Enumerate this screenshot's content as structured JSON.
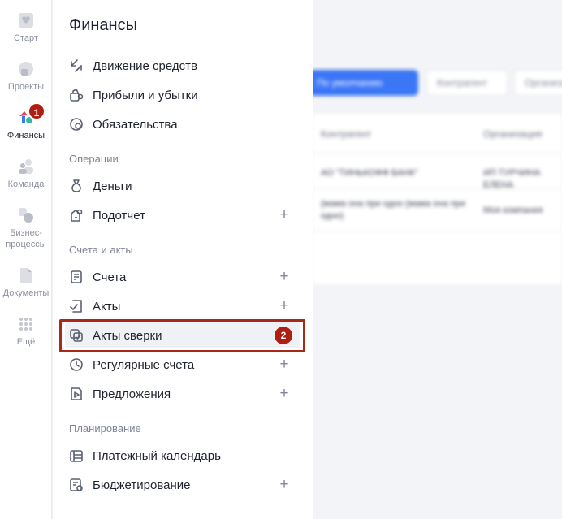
{
  "rail": {
    "items": [
      {
        "label": "Старт",
        "icon": "heart-icon"
      },
      {
        "label": "Проекты",
        "icon": "projects-icon"
      },
      {
        "label": "Финансы",
        "icon": "finance-icon"
      },
      {
        "label": "Команда",
        "icon": "team-icon"
      },
      {
        "label": "Бизнес-\nпроцессы",
        "icon": "business-process-icon"
      },
      {
        "label": "Документы",
        "icon": "document-icon"
      },
      {
        "label": "Ещё",
        "icon": "grid-dots-icon"
      }
    ],
    "finance_badge": "1"
  },
  "menu": {
    "title": "Финансы",
    "top_items": [
      {
        "label": "Движение средств",
        "icon": "transfer-arrows-icon"
      },
      {
        "label": "Прибыли и убытки",
        "icon": "profit-loss-icon"
      },
      {
        "label": "Обязательства",
        "icon": "obligations-icon"
      }
    ],
    "sections": [
      {
        "title": "Операции",
        "items": [
          {
            "label": "Деньги",
            "icon": "money-bag-icon",
            "plus": ""
          },
          {
            "label": "Подотчет",
            "icon": "accountable-icon",
            "plus": "+"
          }
        ]
      },
      {
        "title": "Счета и акты",
        "items": [
          {
            "label": "Счета",
            "icon": "invoice-icon",
            "plus": "+"
          },
          {
            "label": "Акты",
            "icon": "act-icon",
            "plus": "+"
          },
          {
            "label": "Акты сверки",
            "icon": "reconciliation-icon",
            "plus": ""
          },
          {
            "label": "Регулярные счета",
            "icon": "clock-icon",
            "plus": "+"
          },
          {
            "label": "Предложения",
            "icon": "proposal-icon",
            "plus": "+"
          }
        ]
      },
      {
        "title": "Планирование",
        "items": [
          {
            "label": "Платежный календарь",
            "icon": "payment-calendar-icon",
            "plus": ""
          },
          {
            "label": "Бюджетирование",
            "icon": "budget-icon",
            "plus": "+"
          }
        ]
      }
    ],
    "highlight_badge": "2"
  },
  "background": {
    "buttons": [
      "По умолчанию",
      "Контрагент",
      "Организация"
    ],
    "columns": [
      "Контрагент",
      "Организация"
    ],
    "rows": [
      [
        "АО \"ТИНЬКОФФ БАНК\"",
        "ИП ТУРЧИНА ЕЛЕНА"
      ],
      [
        "(мама она при одно (мама она при одно)",
        "Моя компания"
      ]
    ]
  },
  "colors": {
    "accent": "#3b76f6",
    "badge": "#b01e12",
    "highlight_border": "#a8281a"
  }
}
